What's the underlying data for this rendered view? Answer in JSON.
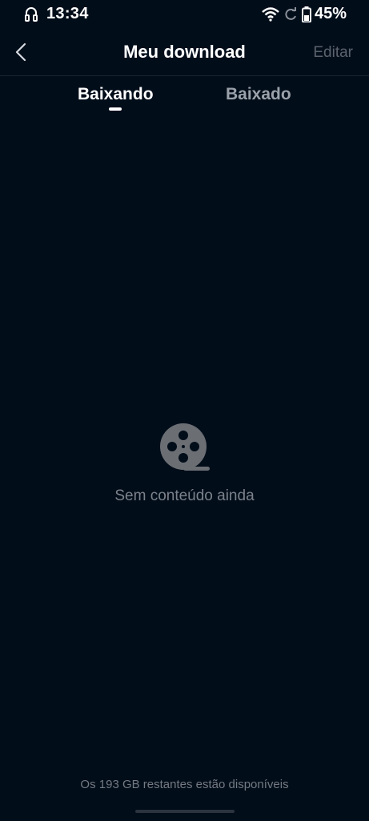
{
  "status_bar": {
    "time": "13:34",
    "battery": "45%",
    "icons": [
      "headset-icon",
      "wifi-icon",
      "sync-icon",
      "battery-icon"
    ]
  },
  "header": {
    "title": "Meu download",
    "edit_label": "Editar",
    "back_icon": "chevron-left-icon"
  },
  "tabs": [
    {
      "label": "Baixando",
      "active": true
    },
    {
      "label": "Baixado",
      "active": false
    }
  ],
  "empty_state": {
    "icon": "film-reel-icon",
    "message": "Sem conteúdo ainda"
  },
  "footer": {
    "storage": "Os 193 GB restantes estão disponíveis"
  },
  "colors": {
    "background": "#020d1a",
    "primary_text": "#ffffff",
    "inactive_text": "#9aa1a9",
    "muted_text": "#7b828b",
    "icon_gray": "#6b6f74"
  }
}
